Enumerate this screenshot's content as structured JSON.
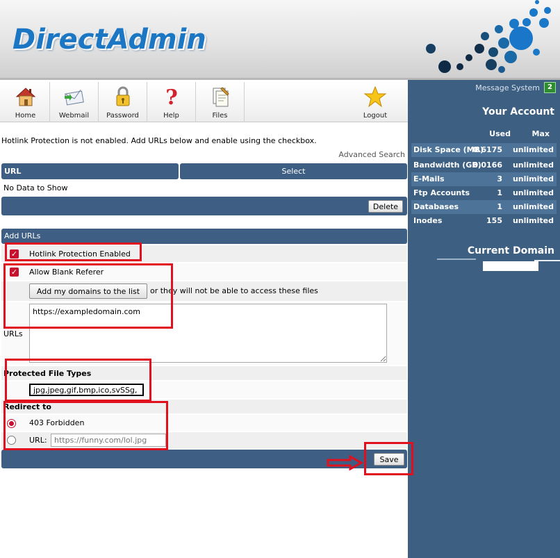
{
  "app": {
    "logo_text": "DirectAdmin"
  },
  "toolbar": {
    "items": [
      {
        "label": "Home",
        "icon": "house-icon"
      },
      {
        "label": "Webmail",
        "icon": "envelope-icon"
      },
      {
        "label": "Password",
        "icon": "padlock-icon"
      },
      {
        "label": "Help",
        "icon": "question-icon"
      },
      {
        "label": "Files",
        "icon": "files-icon"
      },
      {
        "label": "Logout",
        "icon": "star-icon"
      }
    ]
  },
  "sidebar": {
    "message_system": "Message System",
    "message_count": "2",
    "your_account": "Your Account",
    "col_used": "Used",
    "col_max": "Max",
    "usage": [
      {
        "name": "Disk Space (MB)",
        "used": "0.6175",
        "max": "unlimited"
      },
      {
        "name": "Bandwidth (GB)",
        "used": "0.0166",
        "max": "unlimited"
      },
      {
        "name": "E-Mails",
        "used": "3",
        "max": "unlimited"
      },
      {
        "name": "Ftp Accounts",
        "used": "1",
        "max": "unlimited"
      },
      {
        "name": "Databases",
        "used": "1",
        "max": "unlimited"
      },
      {
        "name": "Inodes",
        "used": "155",
        "max": "unlimited"
      }
    ],
    "current_domain": "Current Domain"
  },
  "main": {
    "notice": "Hotlink Protection is not enabled. Add URLs below and enable using the checkbox.",
    "advanced_search": "Advanced Search",
    "table": {
      "col_url": "URL",
      "col_select": "Select",
      "empty": "No Data to Show"
    },
    "delete_label": "Delete",
    "add_urls_title": "Add URLs",
    "hotlink_enabled_label": "Hotlink Protection Enabled",
    "allow_blank_label": "Allow Blank Referer",
    "add_domains_button": "Add my domains to the list",
    "add_domains_hint": "or they will not be able to access these files",
    "urls_label": "URLs",
    "urls_value": "https://exampledomain.com",
    "protected_types_title": "Protected File Types",
    "protected_types_value": "jpg,jpeg,gif,bmp,ico,svSSg,",
    "redirect_title": "Redirect to",
    "forbidden_label": "403 Forbidden",
    "url_label": "URL:",
    "url_placeholder": "https://funny.com/lol.jpg",
    "save_label": "Save"
  },
  "colors": {
    "bar": "#3e5f83",
    "sidebar": "#3d5f82",
    "highlight": "#e0101e",
    "logo": "#1b77c3"
  }
}
